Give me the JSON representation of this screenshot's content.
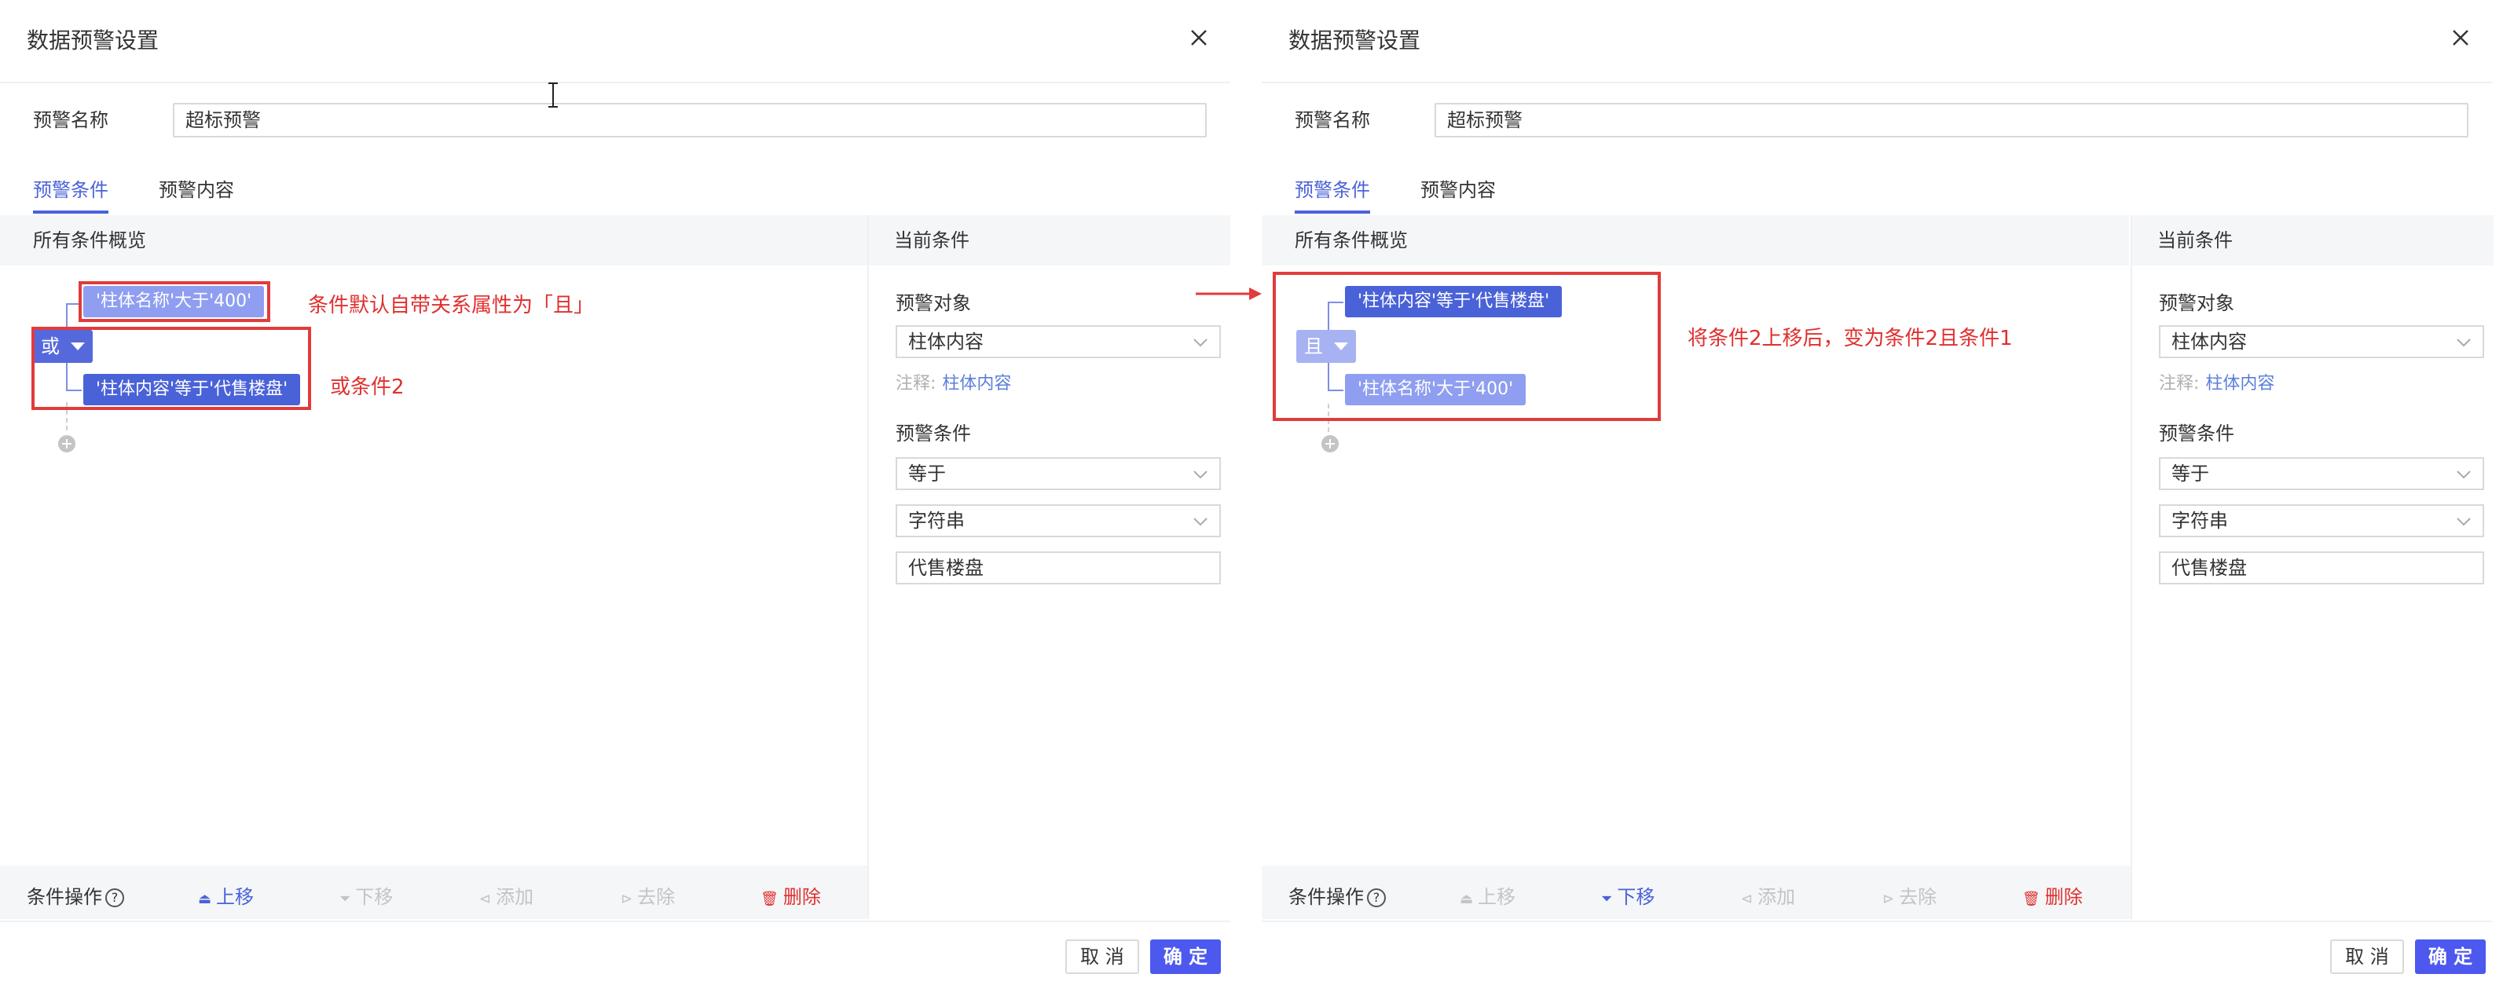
{
  "left": {
    "dialog_title": "数据预警设置",
    "name_label": "预警名称",
    "name_value": "超标预警",
    "tabs": [
      "预警条件",
      "预警内容"
    ],
    "overview_header": "所有条件概览",
    "current_header": "当前条件",
    "relation": "或",
    "node1": "'柱体名称'大于'400'",
    "node2": "'柱体内容'等于'代售楼盘'",
    "annotation1": "条件默认自带关系属性为「且」",
    "annotation2": "或条件2",
    "target_label": "预警对象",
    "target_value": "柱体内容",
    "note_prefix": "注释:",
    "note_value": "柱体内容",
    "condition_label": "预警条件",
    "operator_value": "等于",
    "type_value": "字符串",
    "input_value": "代售楼盘",
    "ops_label": "条件操作",
    "ops": [
      "上移",
      "下移",
      "添加",
      "去除",
      "删除"
    ],
    "cancel_label": "取 消",
    "ok_label": "确 定"
  },
  "right": {
    "dialog_title": "数据预警设置",
    "name_label": "预警名称",
    "name_value": "超标预警",
    "tabs": [
      "预警条件",
      "预警内容"
    ],
    "overview_header": "所有条件概览",
    "current_header": "当前条件",
    "relation": "且",
    "node1": "'柱体内容'等于'代售楼盘'",
    "node2": "'柱体名称'大于'400'",
    "annotation": "将条件2上移后，变为条件2且条件1",
    "target_label": "预警对象",
    "target_value": "柱体内容",
    "note_prefix": "注释:",
    "note_value": "柱体内容",
    "condition_label": "预警条件",
    "operator_value": "等于",
    "type_value": "字符串",
    "input_value": "代售楼盘",
    "ops_label": "条件操作",
    "ops": [
      "上移",
      "下移",
      "添加",
      "去除",
      "删除"
    ],
    "cancel_label": "取 消",
    "ok_label": "确 定"
  },
  "colors": {
    "accent": "#4a62d8",
    "node_selected": "#4a62d8",
    "node_unselected": "#8f9ef0",
    "annotation_red": "#e0302f",
    "danger": "#e0302f",
    "disabled": "#c4c4c4"
  },
  "icons": {
    "close": "close-icon",
    "move_up": "move-up-icon",
    "move_down": "move-down-icon",
    "add": "add-icon",
    "remove": "remove-icon",
    "delete": "trash-icon",
    "help": "help-icon",
    "chevron": "chevron-down-icon"
  }
}
